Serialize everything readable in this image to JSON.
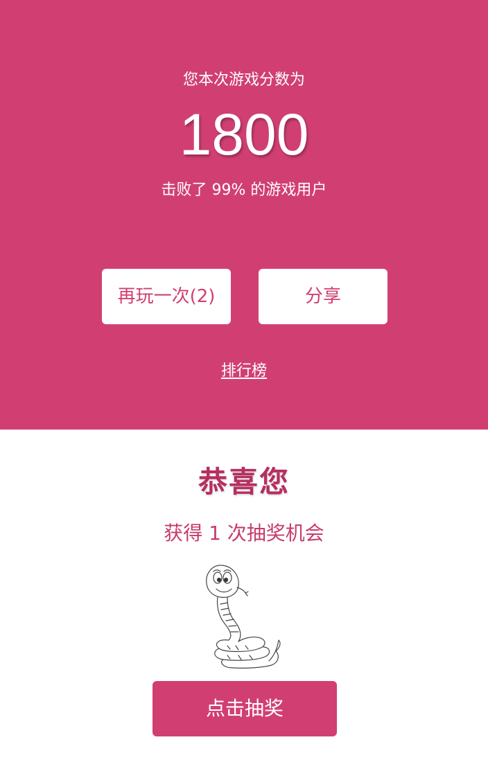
{
  "result": {
    "caption": "您本次游戏分数为",
    "score": "1800",
    "beat_text": "击败了 99% 的游戏用户",
    "replay_label": "再玩一次(2)",
    "share_label": "分享",
    "rank_label": "排行榜"
  },
  "prize": {
    "title": "恭喜您",
    "chance_text": "获得 1 次抽奖机会",
    "draw_label": "点击抽奖",
    "mascot_icon": "snake-mascot-icon"
  },
  "colors": {
    "panel_bg": "#d13f72",
    "title_color": "#b62f60",
    "white": "#ffffff"
  }
}
